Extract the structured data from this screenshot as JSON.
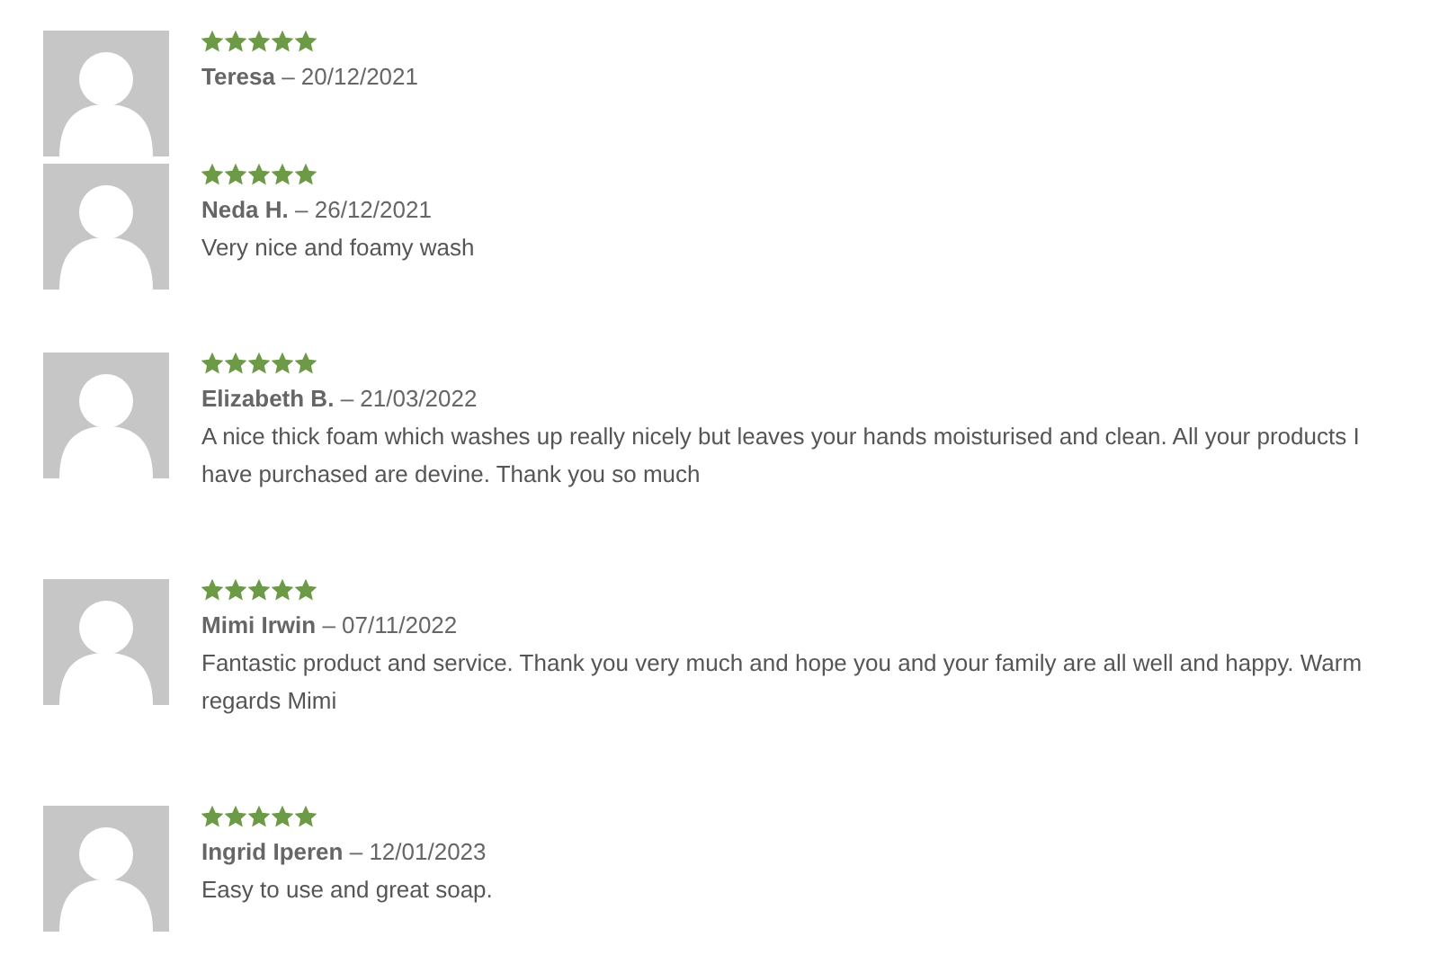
{
  "reviews": [
    {
      "stars": 5,
      "author": "Teresa",
      "date": "– 20/12/2021"
    },
    {
      "stars": 5,
      "author": "Neda H.",
      "date": "– 26/12/2021",
      "text": "Very nice and foamy wash"
    },
    {
      "stars": 5,
      "author": "Elizabeth B.",
      "date": "– 21/03/2022",
      "text": "A nice thick foam which washes up really nicely but leaves your hands moisturised and clean. All your products I have purchased are devine. Thank you so much"
    },
    {
      "stars": 5,
      "author": "Mimi Irwin",
      "date": "– 07/11/2022",
      "text": "Fantastic product and service. Thank you very much and hope you and your family are all well and happy. Warm regards Mimi"
    },
    {
      "stars": 5,
      "author": "Ingrid Iperen",
      "date": "– 12/01/2023",
      "text": "Easy to use and great soap."
    }
  ]
}
